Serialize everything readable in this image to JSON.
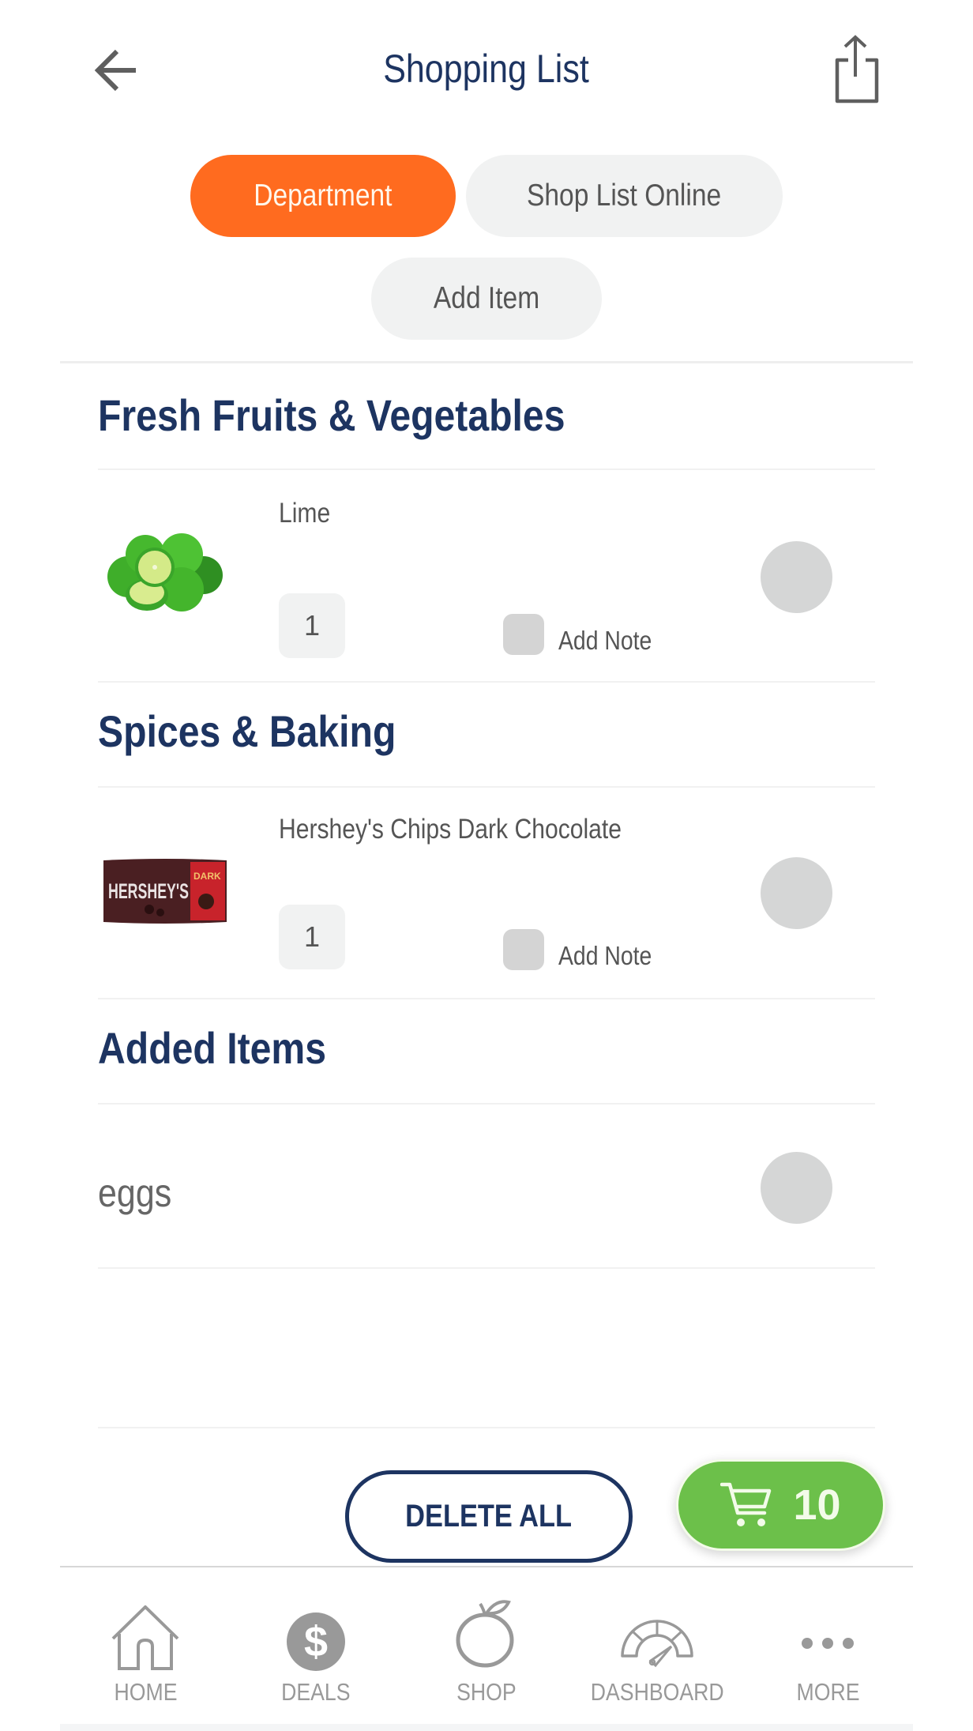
{
  "header": {
    "title": "Shopping List",
    "back_icon": "arrow-left-icon",
    "share_icon": "share-icon"
  },
  "filters": {
    "department": "Department",
    "shop_list_online": "Shop List Online",
    "add_item": "Add Item",
    "active": "Department"
  },
  "sections": [
    {
      "title": "Fresh Fruits & Vegetables",
      "items": [
        {
          "name": "Lime",
          "quantity": "1",
          "note_label": "Add Note",
          "image": "lime-image"
        }
      ]
    },
    {
      "title": "Spices & Baking",
      "items": [
        {
          "name": "Hershey's Chips Dark Chocolate",
          "quantity": "1",
          "note_label": "Add Note",
          "image": "hersheys-chips-image",
          "image_text": "HERSHEY'S",
          "image_badge": "DARK"
        }
      ]
    },
    {
      "title": "Added Items",
      "items": [
        {
          "name": "eggs"
        }
      ]
    }
  ],
  "actions": {
    "delete_all": "DELETE ALL",
    "cart_count": "10",
    "cart_icon": "cart-icon"
  },
  "bottom_nav": [
    {
      "label": "HOME",
      "icon": "home-icon"
    },
    {
      "label": "DEALS",
      "icon": "dollar-icon"
    },
    {
      "label": "SHOP",
      "icon": "apple-icon"
    },
    {
      "label": "DASHBOARD",
      "icon": "gauge-icon"
    },
    {
      "label": "MORE",
      "icon": "more-icon"
    }
  ],
  "colors": {
    "brand_navy": "#1d3461",
    "accent_orange": "#ff6b1f",
    "cart_green": "#6cc04a",
    "pill_grey": "#f1f2f2",
    "control_grey": "#d4d4d4",
    "nav_grey": "#999999"
  }
}
